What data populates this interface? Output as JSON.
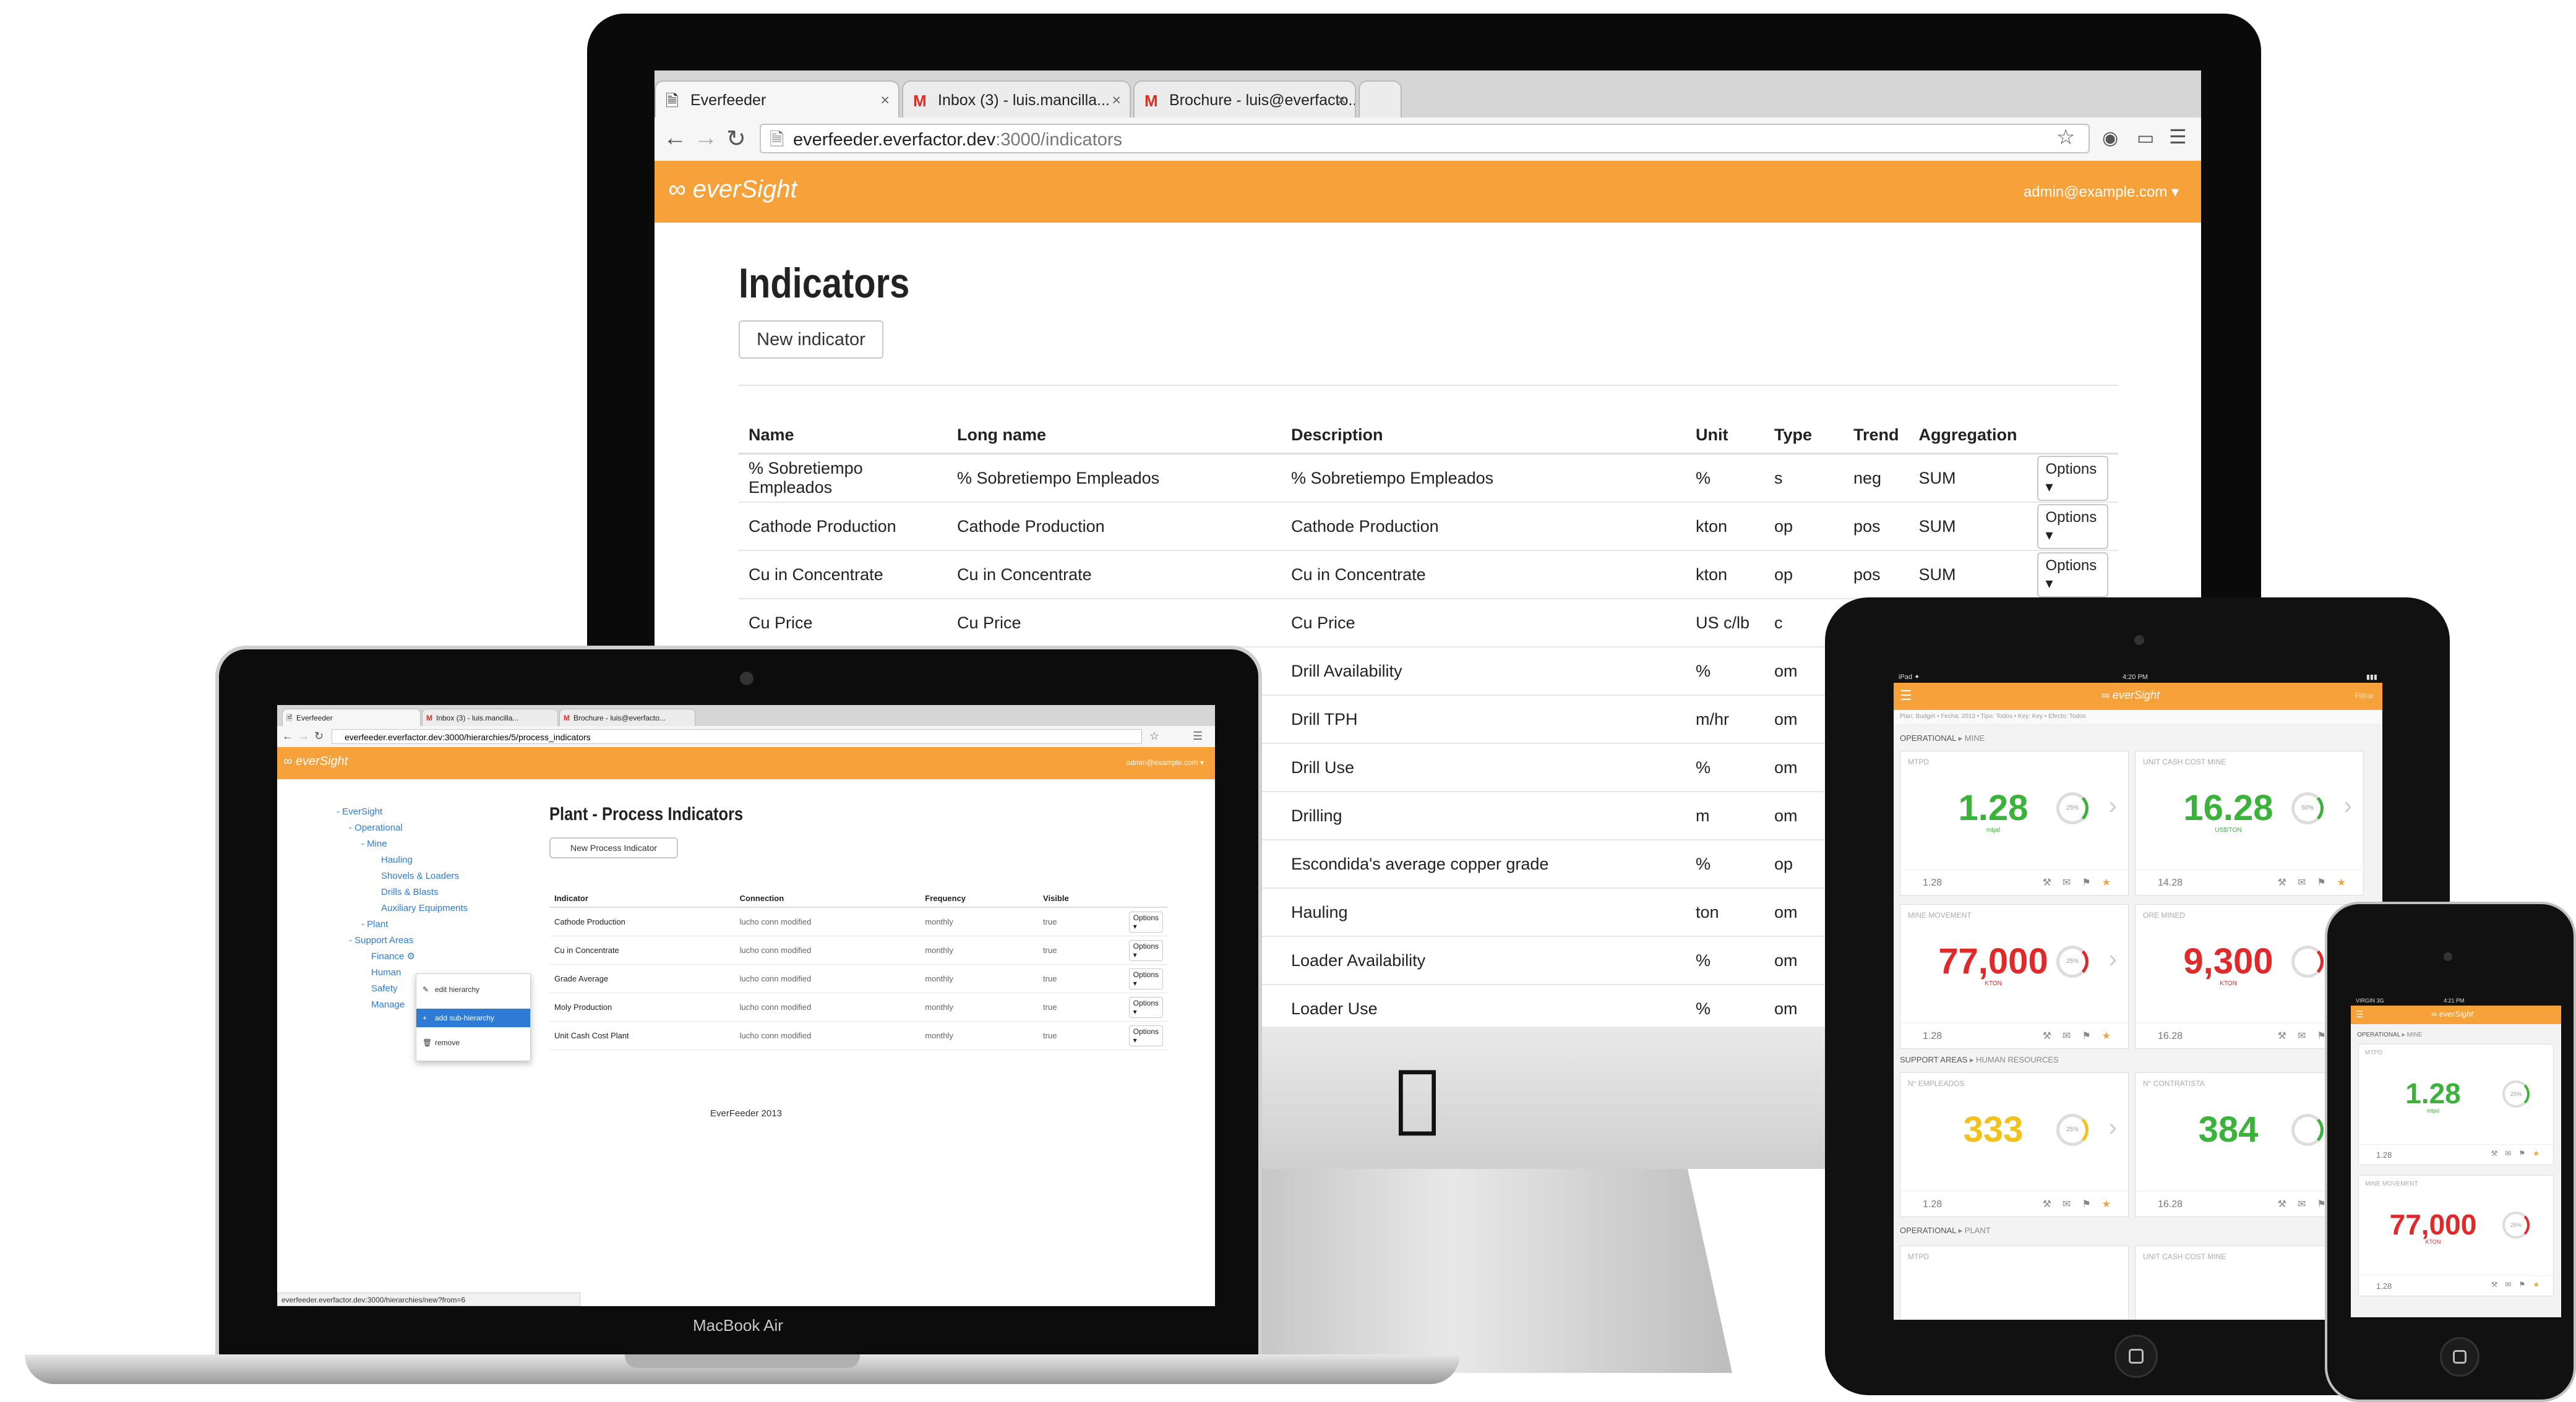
{
  "colors": {
    "brand_orange": "#f7a13b",
    "green": "#3bb33b",
    "red": "#e02a2a",
    "yellow": "#f2c21b",
    "link_blue": "#2e7bd6"
  },
  "imac": {
    "tabs": [
      {
        "icon": "page-icon",
        "label": "Everfeeder"
      },
      {
        "icon": "gmail-icon",
        "label": "Inbox (3) - luis.mancilla..."
      },
      {
        "icon": "gmail-icon",
        "label": "Brochure - luis@everfacto..."
      }
    ],
    "url_host": "everfeeder.everfactor.dev",
    "url_path": ":3000/indicators",
    "brand": "everSight",
    "user_menu": "admin@example.com ▾",
    "page_title": "Indicators",
    "new_button": "New indicator",
    "columns": [
      "Name",
      "Long name",
      "Description",
      "Unit",
      "Type",
      "Trend",
      "Aggregation",
      ""
    ],
    "options_label": "Options ▾",
    "rows": [
      {
        "name": "% Sobretiempo Empleados",
        "long": "% Sobretiempo Empleados",
        "desc": "% Sobretiempo Empleados",
        "unit": "%",
        "type": "s",
        "trend": "neg",
        "agg": "SUM"
      },
      {
        "name": "Cathode Production",
        "long": "Cathode Production",
        "desc": "Cathode Production",
        "unit": "kton",
        "type": "op",
        "trend": "pos",
        "agg": "SUM"
      },
      {
        "name": "Cu in Concentrate",
        "long": "Cu in Concentrate",
        "desc": "Cu in Concentrate",
        "unit": "kton",
        "type": "op",
        "trend": "pos",
        "agg": "SUM"
      },
      {
        "name": "Cu Price",
        "long": "Cu Price",
        "desc": "Cu Price",
        "unit": "US c/lb",
        "type": "c",
        "trend": "",
        "agg": ""
      },
      {
        "name": "",
        "long": "",
        "desc": "Drill Availability",
        "unit": "%",
        "type": "om",
        "trend": "",
        "agg": ""
      },
      {
        "name": "",
        "long": "",
        "desc": "Drill TPH",
        "unit": "m/hr",
        "type": "om",
        "trend": "",
        "agg": ""
      },
      {
        "name": "",
        "long": "",
        "desc": "Drill Use",
        "unit": "%",
        "type": "om",
        "trend": "",
        "agg": ""
      },
      {
        "name": "",
        "long": "",
        "desc": "Drilling",
        "unit": "m",
        "type": "om",
        "trend": "",
        "agg": ""
      },
      {
        "name": "",
        "long": "",
        "desc": "Escondida's average copper grade",
        "unit": "%",
        "type": "op",
        "trend": "",
        "agg": ""
      },
      {
        "name": "",
        "long": "",
        "desc": "Hauling",
        "unit": "ton",
        "type": "om",
        "trend": "",
        "agg": ""
      },
      {
        "name": "",
        "long": "",
        "desc": "Loader Availability",
        "unit": "%",
        "type": "om",
        "trend": "",
        "agg": ""
      },
      {
        "name": "",
        "long": "",
        "desc": "Loader Use",
        "unit": "%",
        "type": "om",
        "trend": "",
        "agg": ""
      }
    ]
  },
  "macbook": {
    "tabs": [
      {
        "label": "Everfeeder"
      },
      {
        "label": "Inbox (3) - luis.mancilla..."
      },
      {
        "label": "Brochure - luis@everfacto..."
      }
    ],
    "url": "everfeeder.everfactor.dev:3000/hierarchies/5/process_indicators",
    "brand": "everSight",
    "user_menu": "admin@example.com ▾",
    "tree": {
      "root": "EverSight",
      "operational": "Operational",
      "mine": "Mine",
      "hauling": "Hauling",
      "shovels": "Shovels & Loaders",
      "drills": "Drills & Blasts",
      "aux": "Auxiliary Equipments",
      "plant": "Plant",
      "support": "Support Areas",
      "finance": "Finance",
      "human": "Human",
      "safety": "Safety",
      "manage": "Manage"
    },
    "context_menu": [
      "edit hierarchy",
      "add sub-hierarchy",
      "remove"
    ],
    "page_title": "Plant - Process Indicators",
    "new_button": "New Process Indicator",
    "columns": [
      "Indicator",
      "Connection",
      "Frequency",
      "Visible",
      ""
    ],
    "options_label": "Options ▾",
    "rows": [
      {
        "indicator": "Cathode Production",
        "connection": "lucho conn modified",
        "frequency": "monthly",
        "visible": "true"
      },
      {
        "indicator": "Cu in Concentrate",
        "connection": "lucho conn modified",
        "frequency": "monthly",
        "visible": "true"
      },
      {
        "indicator": "Grade Average",
        "connection": "lucho conn modified",
        "frequency": "monthly",
        "visible": "true"
      },
      {
        "indicator": "Moly Production",
        "connection": "lucho conn modified",
        "frequency": "monthly",
        "visible": "true"
      },
      {
        "indicator": "Unit Cash Cost Plant",
        "connection": "lucho conn modified",
        "frequency": "monthly",
        "visible": "true"
      }
    ],
    "footer": "EverFeeder 2013",
    "status_url": "everfeeder.everfactor.dev:3000/hierarchies/new?from=6",
    "device_label": "MacBook Air"
  },
  "ipad": {
    "status_left": "iPad ✦",
    "status_time": "4:20 PM",
    "brand": "everSight",
    "filter": "Filtrar",
    "crumbs": "Plan: Budget • Fecha: 2013 • Tipo: Todos • Key: Key • Efecto: Todos",
    "sections": [
      {
        "main": "OPERATIONAL",
        "sub": "MINE"
      },
      {
        "main": "SUPPORT AREAS",
        "sub": "HUMAN RESOURCES"
      },
      {
        "main": "OPERATIONAL",
        "sub": "PLANT"
      }
    ],
    "cards": [
      {
        "title": "MTPD",
        "value": "1.28",
        "unit": "mtpd",
        "ring": "25%",
        "foot": "1.28",
        "color": "green"
      },
      {
        "title": "UNIT CASH COST MINE",
        "value": "16.28",
        "unit": "US$/TON",
        "ring": "50%",
        "foot": "14.28",
        "color": "green"
      },
      {
        "title": "MINE MOVEMENT",
        "value": "77,000",
        "unit": "KTON",
        "ring": "25%",
        "foot": "1.28",
        "color": "red"
      },
      {
        "title": "ORE MINED",
        "value": "9,300",
        "unit": "KTON",
        "ring": "",
        "foot": "16.28",
        "color": "red"
      },
      {
        "title": "N° EMPLEADOS",
        "value": "333",
        "unit": "",
        "ring": "25%",
        "foot": "1.28",
        "color": "yellow"
      },
      {
        "title": "N° CONTRATISTA",
        "value": "384",
        "unit": "",
        "ring": "",
        "foot": "16.28",
        "color": "green"
      },
      {
        "title": "MTPD",
        "value": "",
        "unit": "",
        "ring": "",
        "foot": "",
        "color": "green"
      },
      {
        "title": "UNIT CASH COST MINE",
        "value": "",
        "unit": "",
        "ring": "",
        "foot": "",
        "color": "green"
      }
    ]
  },
  "iphone": {
    "status_left": "VIRGIN 3G",
    "status_time": "4:21 PM",
    "brand": "everSight",
    "section": {
      "main": "OPERATIONAL",
      "sub": "MINE"
    },
    "cards": [
      {
        "title": "MTPD",
        "value": "1.28",
        "unit": "mtpd",
        "ring": "25%",
        "foot": "1.28",
        "color": "green"
      },
      {
        "title": "MINE MOVEMENT",
        "value": "77,000",
        "unit": "KTON",
        "ring": "25%",
        "foot": "1.28",
        "color": "red"
      }
    ]
  }
}
